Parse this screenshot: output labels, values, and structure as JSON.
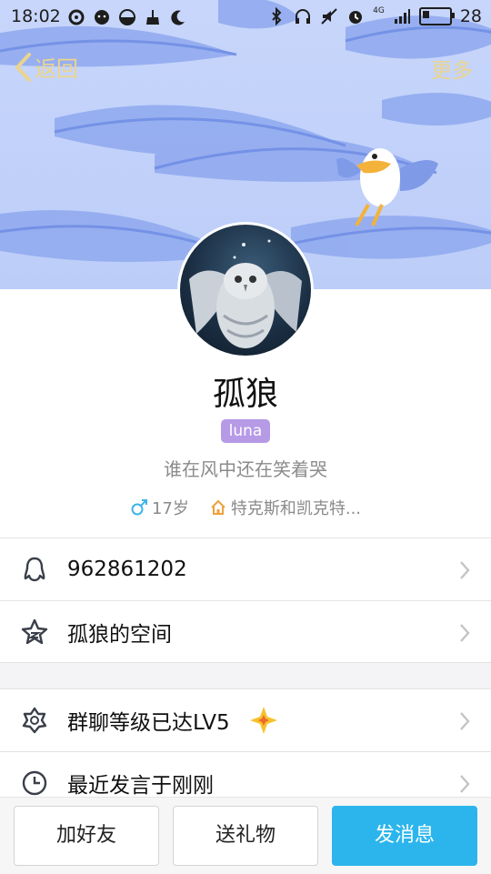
{
  "status_bar": {
    "time": "18:02",
    "network": "4G",
    "battery": "28",
    "battery_level": 0.28
  },
  "nav": {
    "back_label": "返回",
    "more_label": "更多"
  },
  "profile": {
    "name": "孤狼",
    "tag": "luna",
    "signature": "谁在风中还在笑着哭",
    "age": "17岁",
    "location": "特克斯和凯克特..."
  },
  "rows": [
    {
      "label": "962861202",
      "icon": "qq-penguin-icon"
    },
    {
      "label": "孤狼的空间",
      "icon": "qzone-star-icon"
    },
    {
      "label": "群聊等级已达LV5",
      "icon": "group-level-star-icon"
    },
    {
      "label": "最近发言于刚刚",
      "icon": "clock-icon"
    }
  ],
  "actions": {
    "add_friend": "加好友",
    "send_gift": "送礼物",
    "send_message": "发消息"
  },
  "colors": {
    "accent": "#2bb5ec",
    "tag_bg": "#b69ae6",
    "nav_text": "#ead48e",
    "cover_bg": "#c8d6fb"
  }
}
